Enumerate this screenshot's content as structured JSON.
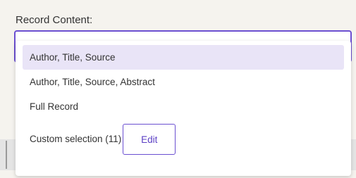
{
  "record_content": {
    "label": "Record Content:",
    "options": [
      "Author, Title, Source",
      "Author, Title, Source, Abstract",
      "Full Record"
    ],
    "selected_option": "Author, Title, Source",
    "custom_selection_label": "Custom selection (11)",
    "edit_label": "Edit"
  },
  "colors": {
    "accent": "#6b4fd1",
    "selected_background": "#e9e4f7",
    "page_background": "#f5f3ee"
  }
}
